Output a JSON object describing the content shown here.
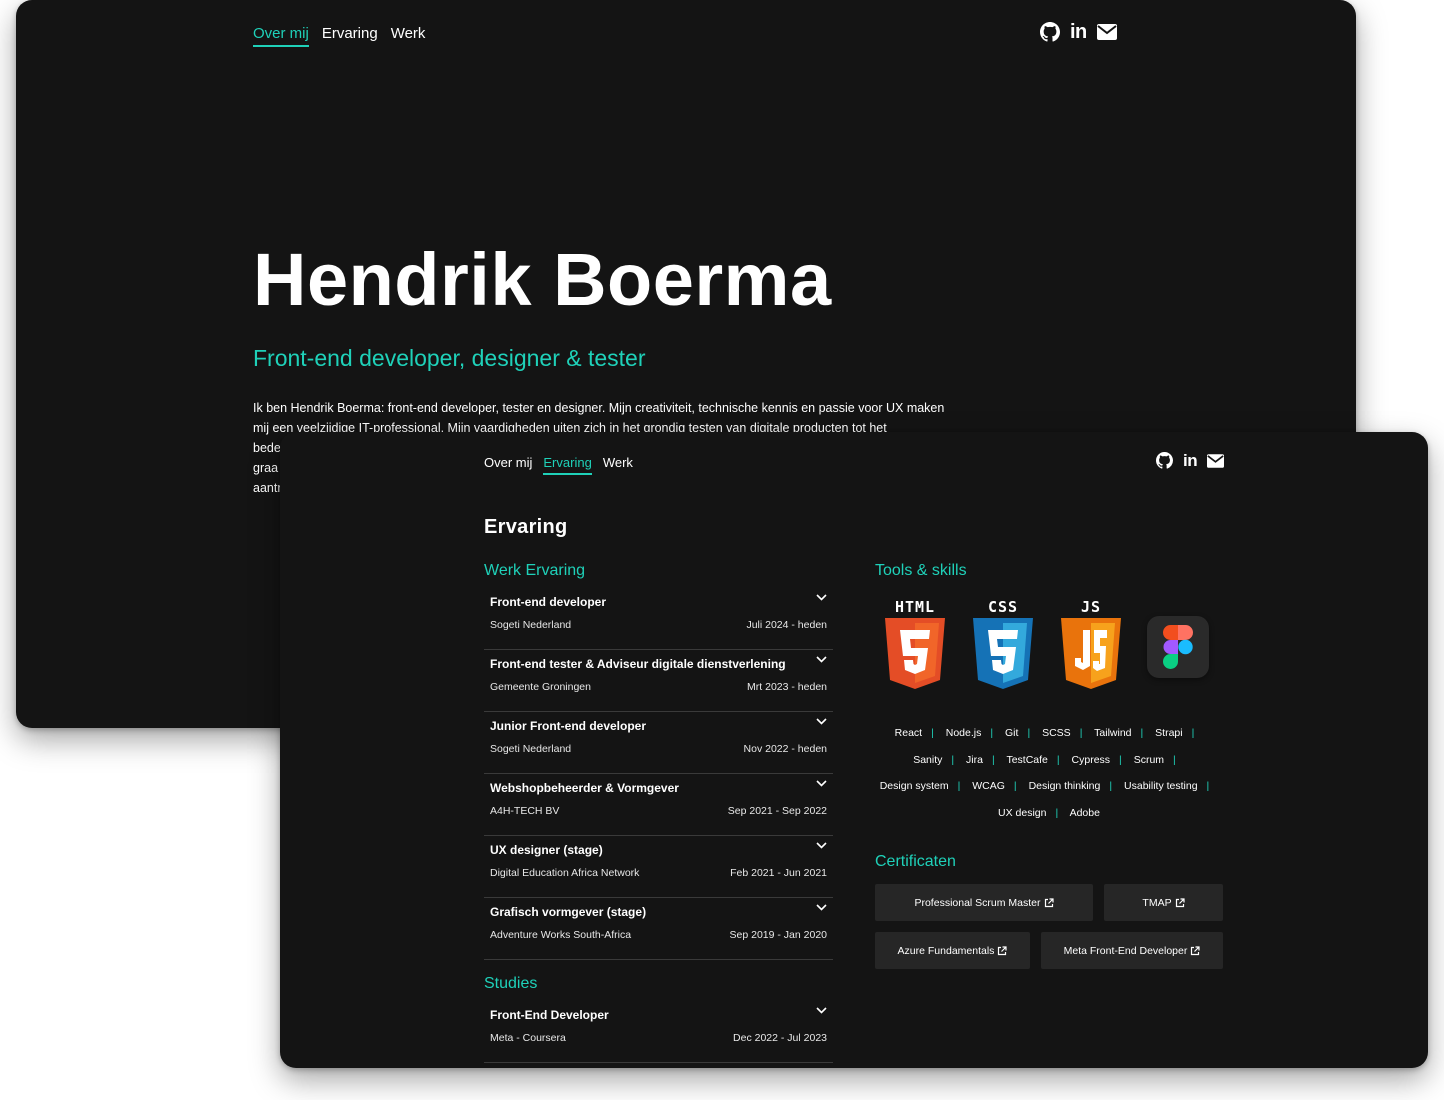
{
  "nav": {
    "about": "Over mij",
    "experience": "Ervaring",
    "work": "Werk"
  },
  "social_icons": [
    "github-icon",
    "linkedin-icon",
    "envelope-icon"
  ],
  "linkedin_text": "in",
  "hero": {
    "name": "Hendrik Boerma",
    "subtitle": "Front-end developer, designer & tester",
    "bio_lines": [
      "Ik ben Hendrik Boerma: front-end developer, tester en designer. Mijn creativiteit, technische kennis en passie voor UX maken",
      "mij een veelzijdige IT-professional. Mijn vaardigheden uiten zich in het grondig testen van digitale producten tot het",
      "bede",
      "graa",
      "aantr"
    ]
  },
  "experience_page": {
    "title": "Ervaring",
    "work_title": "Werk Ervaring",
    "work": [
      {
        "role": "Front-end developer",
        "org": "Sogeti Nederland",
        "period": "Juli 2024 - heden"
      },
      {
        "role": "Front-end tester & Adviseur digitale dienstverlening",
        "org": "Gemeente Groningen",
        "period": "Mrt 2023 - heden"
      },
      {
        "role": "Junior Front-end developer",
        "org": "Sogeti Nederland",
        "period": "Nov 2022 - heden"
      },
      {
        "role": "Webshopbeheerder & Vormgever",
        "org": "A4H-TECH BV",
        "period": "Sep 2021 - Sep 2022"
      },
      {
        "role": "UX designer (stage)",
        "org": "Digital Education Africa Network",
        "period": "Feb 2021 - Jun 2021"
      },
      {
        "role": "Grafisch vormgever (stage)",
        "org": "Adventure Works South-Africa",
        "period": "Sep 2019 - Jan 2020"
      }
    ],
    "studies_title": "Studies",
    "studies": [
      {
        "role": "Front-End Developer",
        "org": "Meta - Coursera",
        "period": "Dec 2022 - Jul 2023"
      }
    ],
    "tools_title": "Tools & skills",
    "logos": {
      "html": "HTML",
      "css": "CSS",
      "js": "JS"
    },
    "logo_icons": [
      "html5-icon",
      "css3-icon",
      "javascript-icon",
      "figma-icon"
    ],
    "skills": [
      "React",
      "Node.js",
      "Git",
      "SCSS",
      "Tailwind",
      "Strapi",
      "Sanity",
      "Jira",
      "TestCafe",
      "Cypress",
      "Scrum",
      "Design system",
      "WCAG",
      "Design thinking",
      "Usability testing",
      "UX design",
      "Adobe"
    ],
    "skill_separator": "|",
    "certs_title": "Certificaten",
    "certs": [
      "Professional Scrum Master",
      "TMAP",
      "Azure Fundamentals",
      "Meta Front-End Developer"
    ]
  },
  "colors": {
    "background": "#141414",
    "accent": "#1fd1b9",
    "text": "#ffffff",
    "button": "#262626",
    "divider": "#3a3a3a"
  }
}
